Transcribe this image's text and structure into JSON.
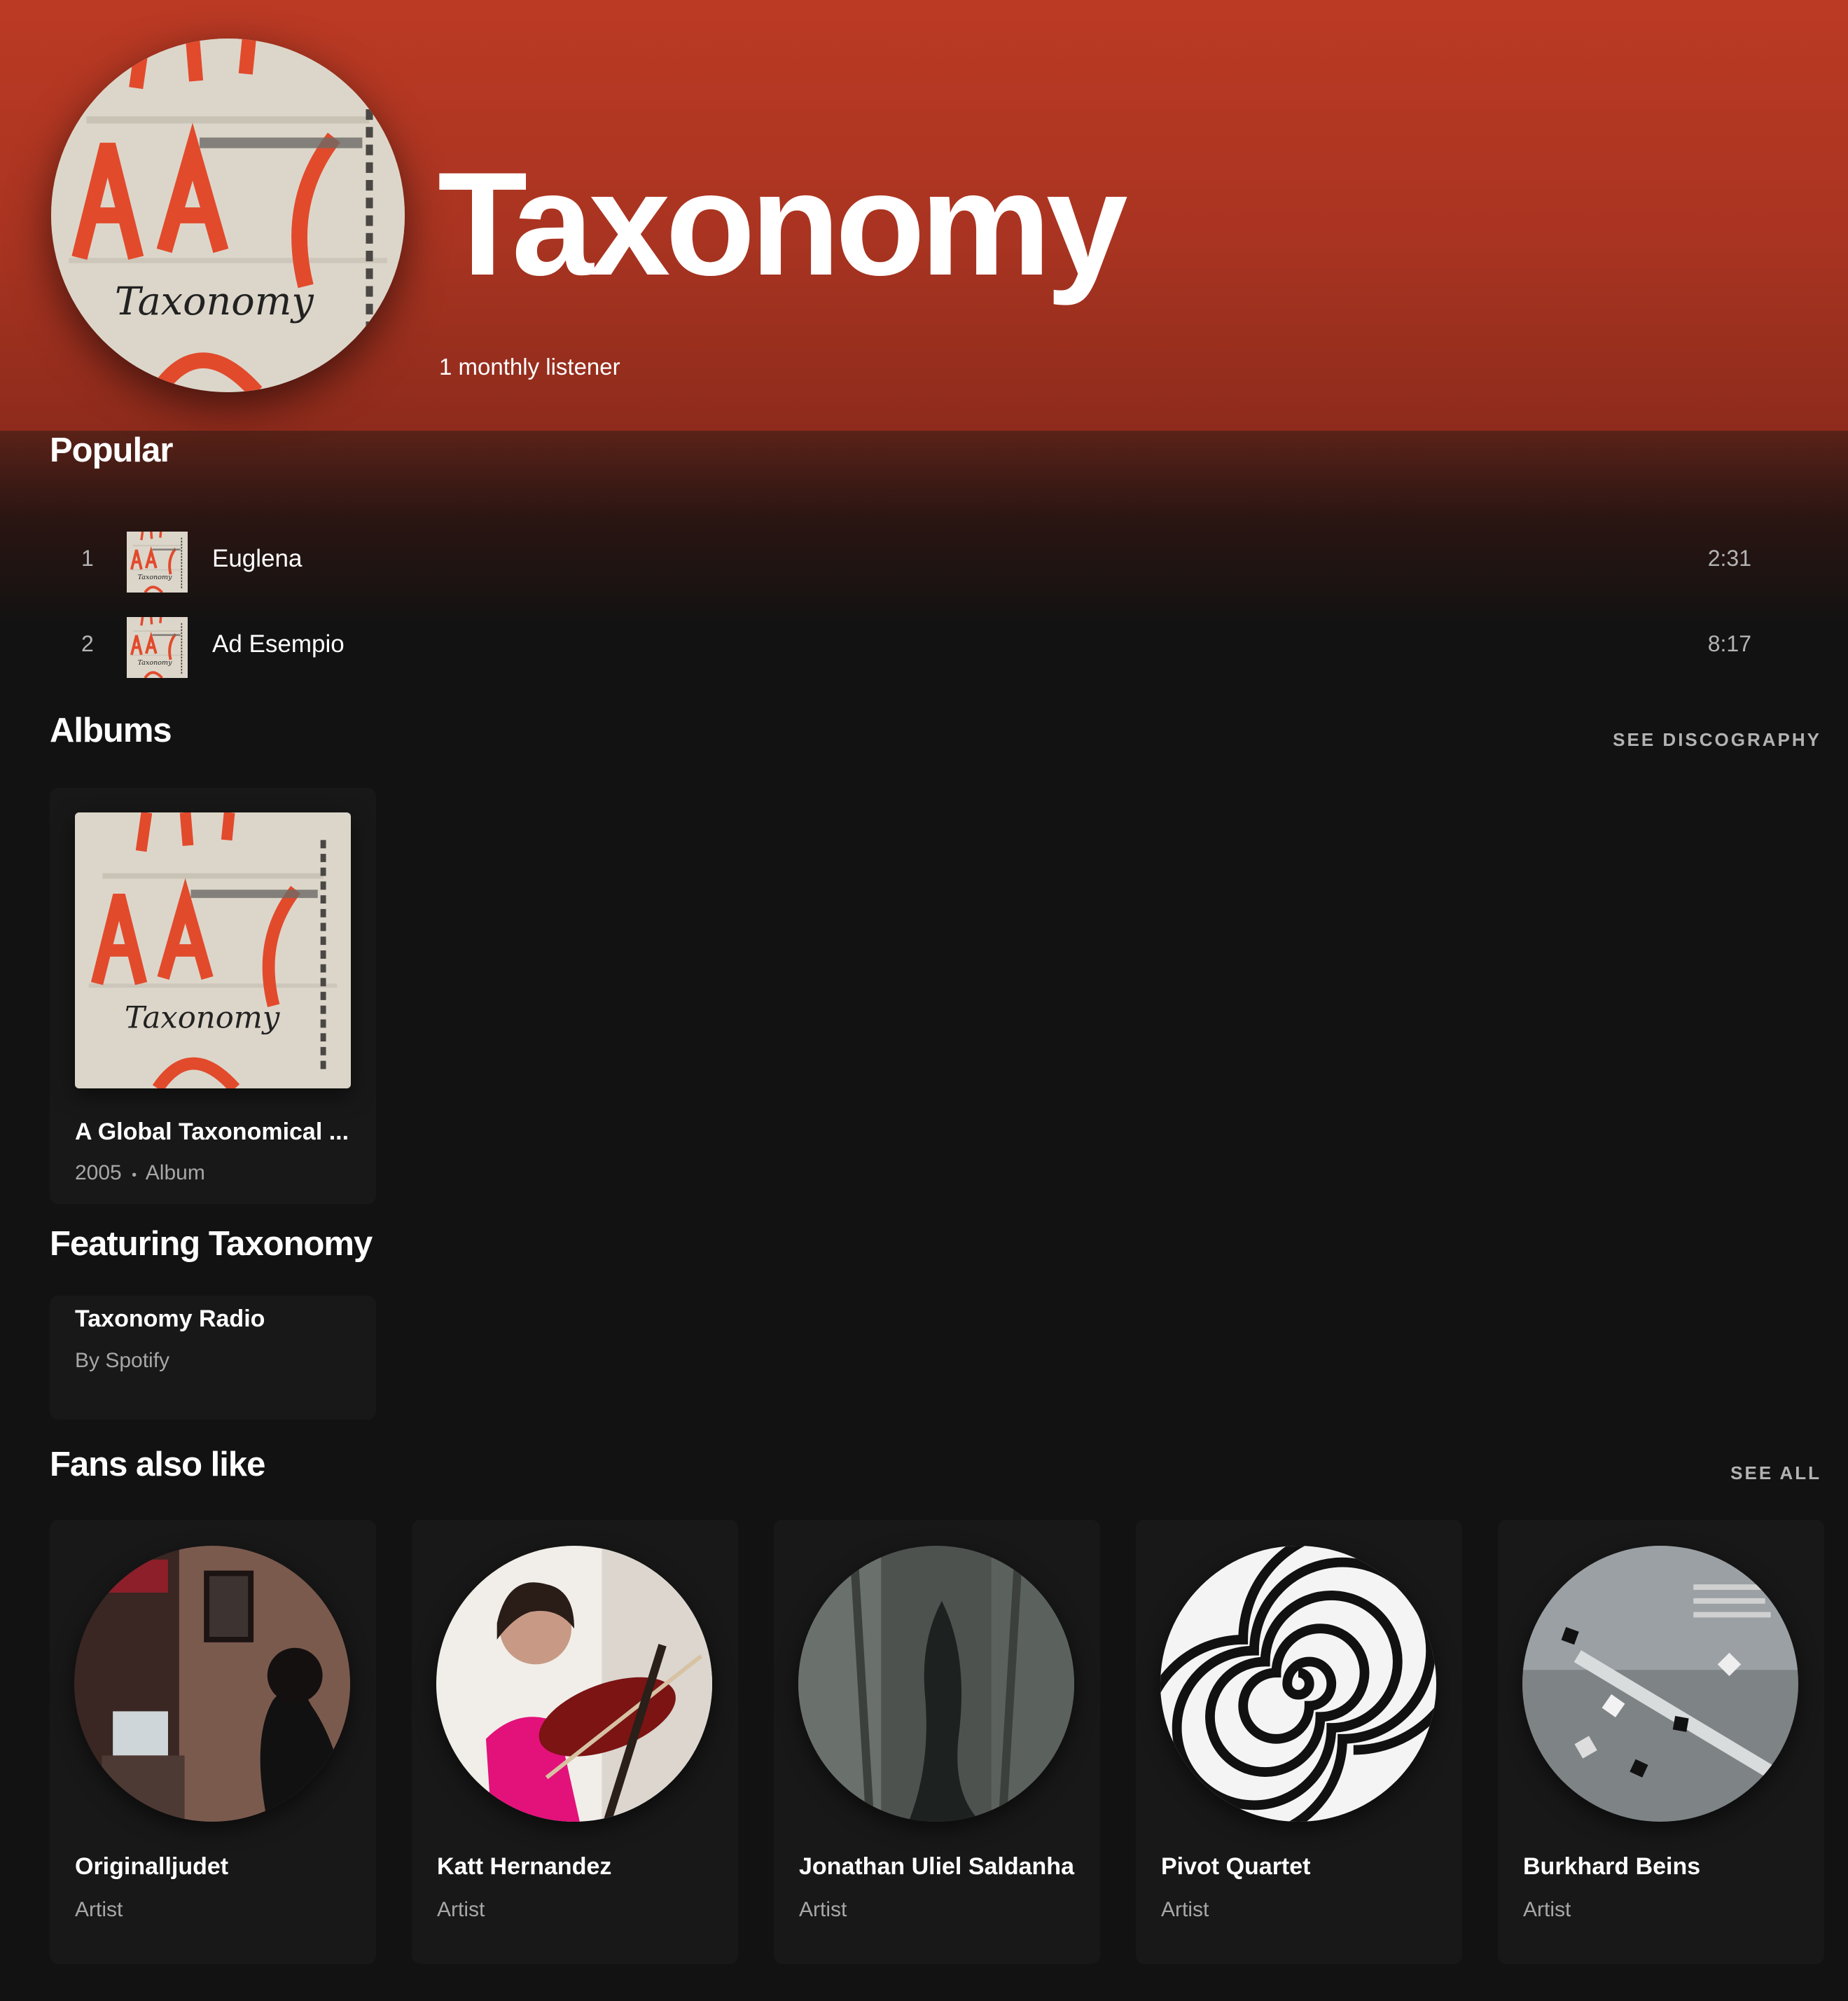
{
  "artist": {
    "name": "Taxonomy",
    "monthly_listeners": "1 monthly listener",
    "image_text": "Taxonomy"
  },
  "popular": {
    "title": "Popular",
    "tracks": [
      {
        "rank": "1",
        "title": "Euglena",
        "duration": "2:31"
      },
      {
        "rank": "2",
        "title": "Ad Esempio",
        "duration": "8:17"
      }
    ]
  },
  "albums": {
    "title": "Albums",
    "see_link": "SEE DISCOGRAPHY",
    "items": [
      {
        "title": "A Global Taxonomical ...",
        "year": "2005",
        "separator": "•",
        "type": "Album"
      }
    ]
  },
  "featuring": {
    "title": "Featuring Taxonomy",
    "items": [
      {
        "title": "Taxonomy Radio",
        "subtitle": "By Spotify"
      }
    ]
  },
  "fans": {
    "title": "Fans also like",
    "see_link": "SEE ALL",
    "items": [
      {
        "name": "Originalljudet",
        "subtitle": "Artist"
      },
      {
        "name": "Katt Hernandez",
        "subtitle": "Artist"
      },
      {
        "name": "Jonathan Uliel Saldanha",
        "subtitle": "Artist"
      },
      {
        "name": "Pivot Quartet",
        "subtitle": "Artist"
      },
      {
        "name": "Burkhard Beins",
        "subtitle": "Artist"
      }
    ]
  },
  "colors": {
    "header": "#bb3a24",
    "background": "#121212",
    "card": "#181818",
    "muted_text": "#b3b3b3"
  }
}
